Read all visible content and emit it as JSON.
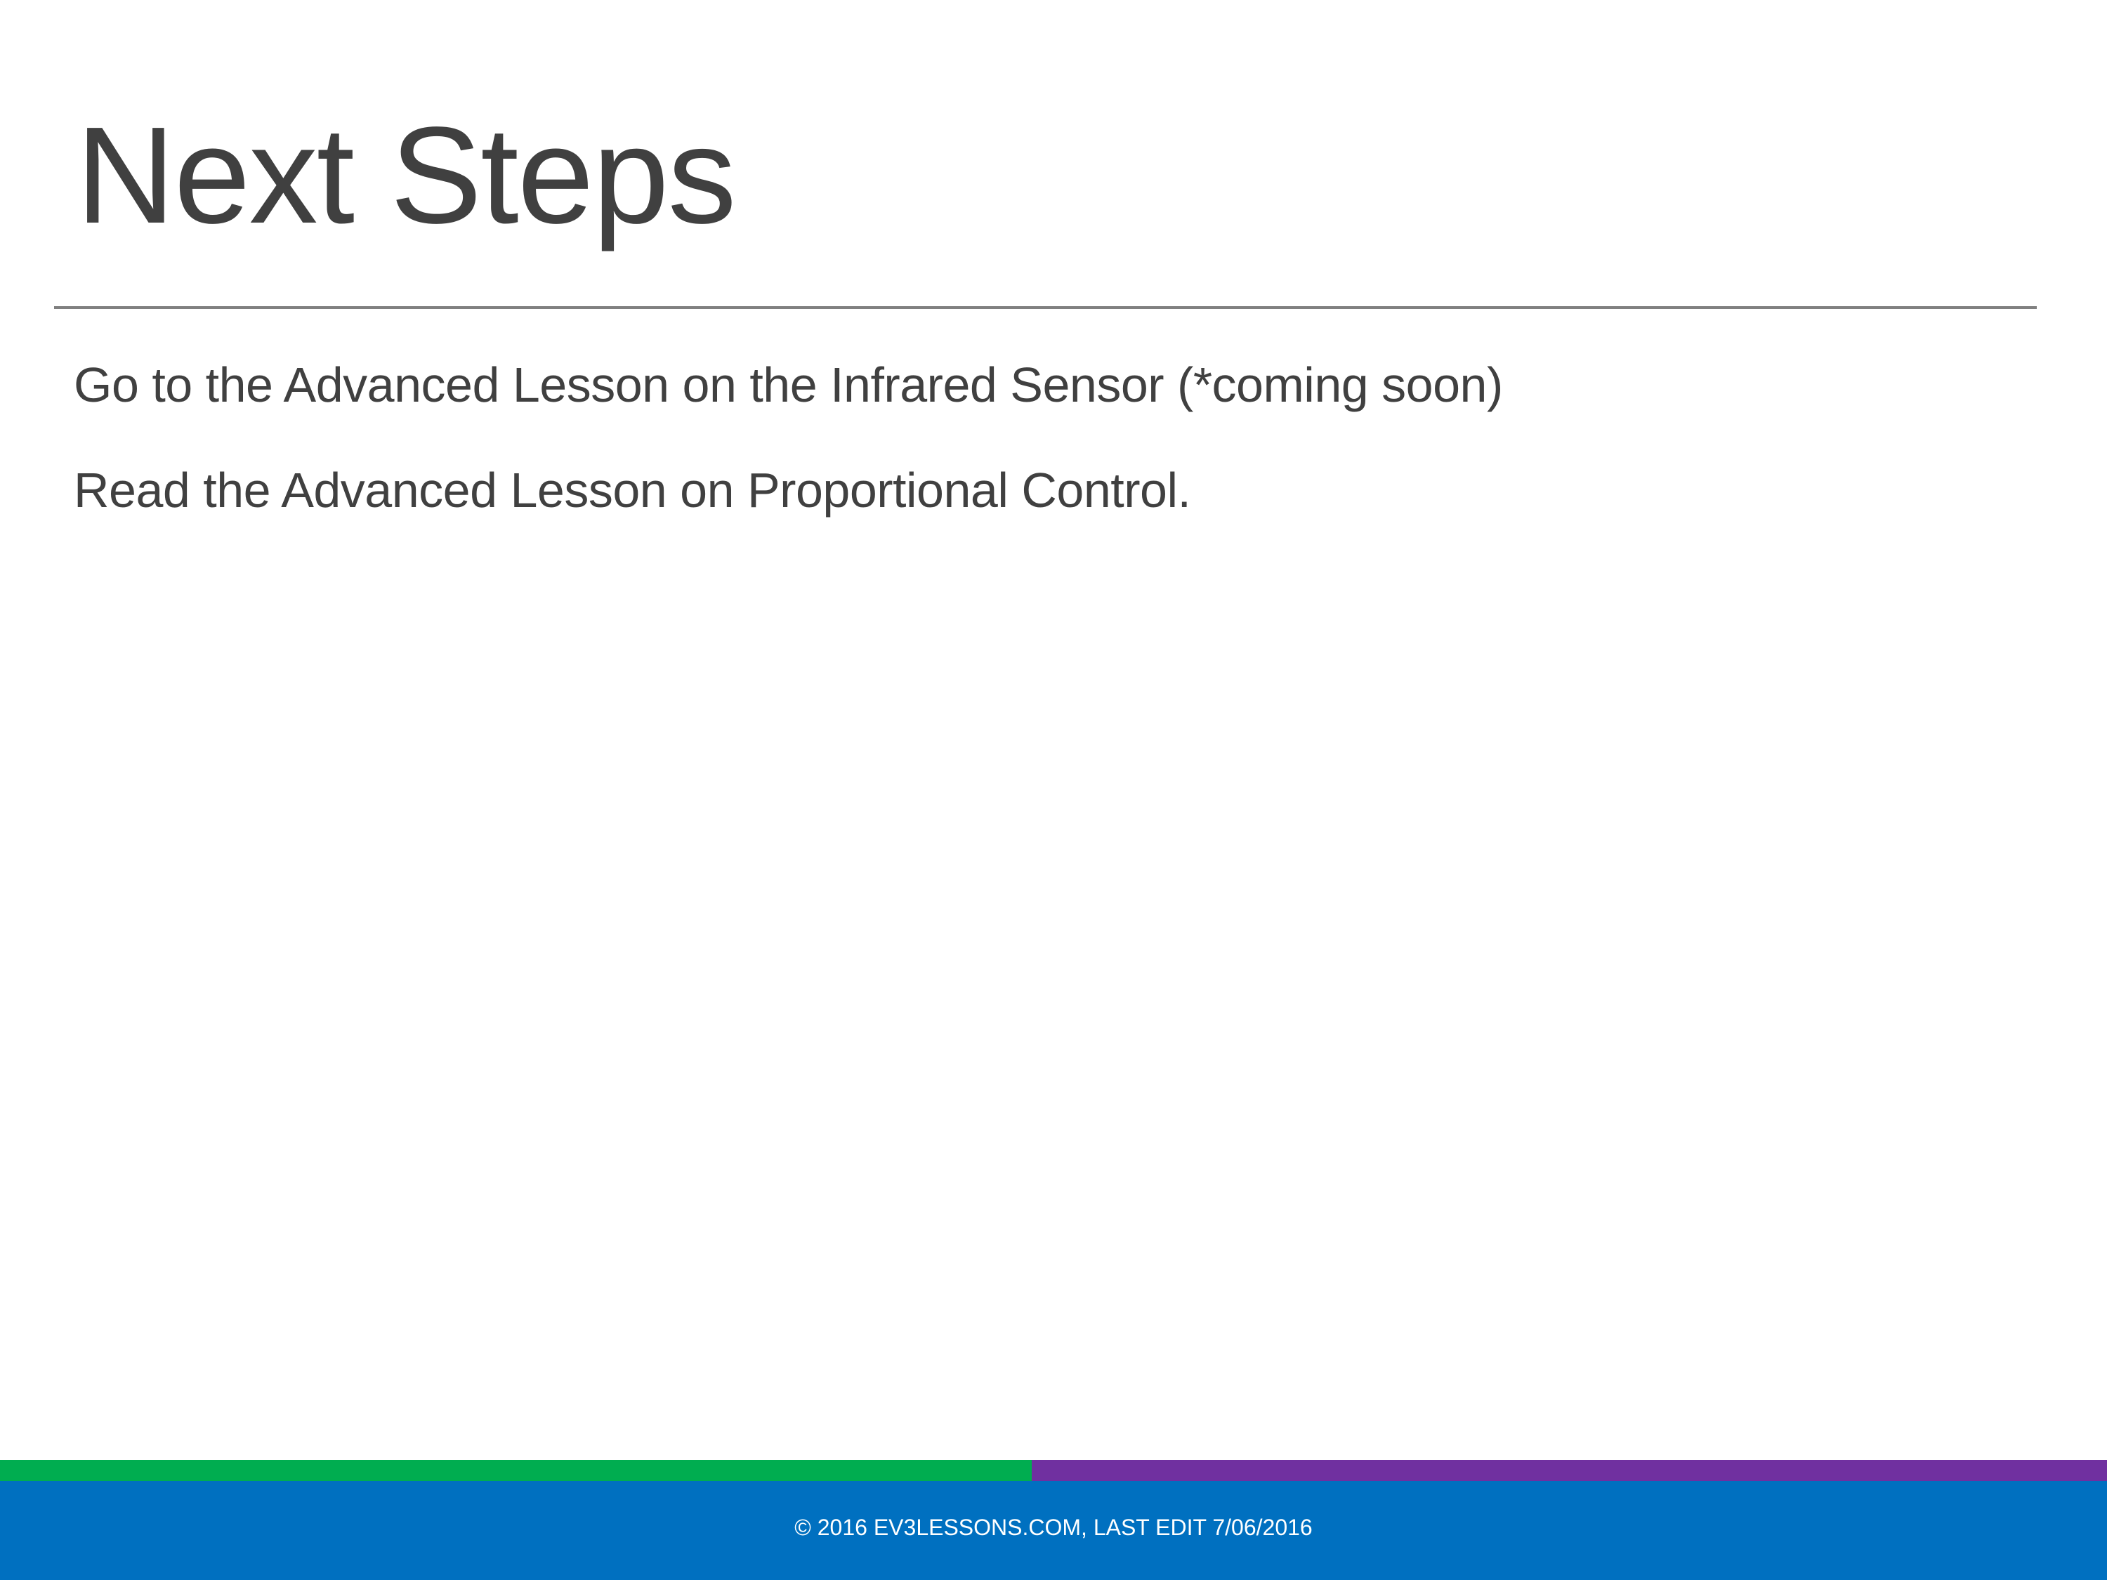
{
  "slide": {
    "title": "Next Steps",
    "body": [
      "Go to the Advanced Lesson on the Infrared Sensor (*coming soon)",
      "Read the Advanced Lesson on Proportional Control."
    ],
    "footer": "© 2016 EV3LESSONS.COM, LAST EDIT 7/06/2016"
  },
  "colors": {
    "band_green": "#00AD50",
    "band_purple": "#7030A0",
    "footer_blue": "#0070C0",
    "text": "#404040"
  }
}
